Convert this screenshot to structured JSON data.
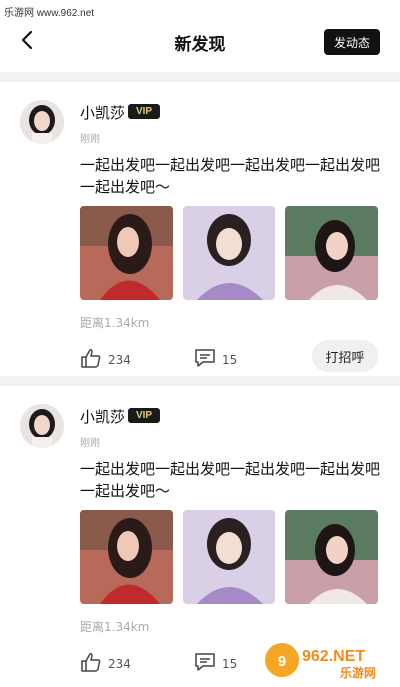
{
  "watermark": "乐游网 www.962.net",
  "header": {
    "title": "新发现",
    "post_button": "发动态"
  },
  "posts": [
    {
      "username": "小凯莎",
      "vip": "VIP",
      "time": "刚刚",
      "text": "一起出发吧一起出发吧一起出发吧一起出发吧一起出发吧～",
      "distance": "距离1.34km",
      "likes": "234",
      "comments": "15",
      "greet": "打招呼"
    },
    {
      "username": "小凯莎",
      "vip": "VIP",
      "time": "刚刚",
      "text": "一起出发吧一起出发吧一起出发吧一起出发吧一起出发吧～",
      "distance": "距离1.34km",
      "likes": "234",
      "comments": "15"
    }
  ],
  "logo": {
    "brand": "962.NET",
    "sub": "乐游网"
  },
  "colors": {
    "vip_bg": "#1b1b1b",
    "vip_text": "#e5c47a",
    "divider": "#f2f2f2"
  }
}
